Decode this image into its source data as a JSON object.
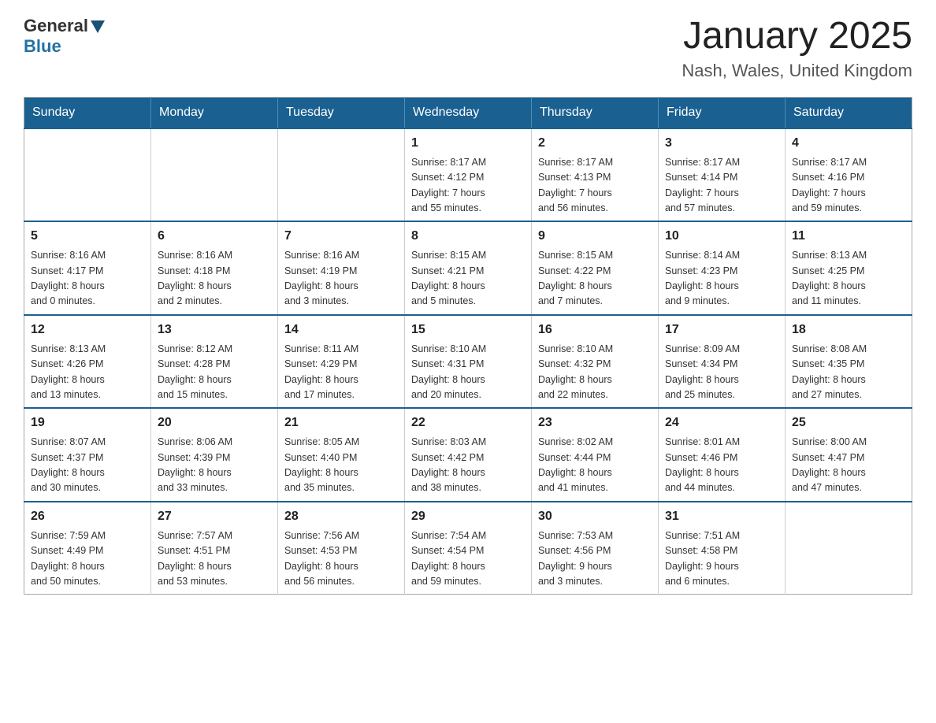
{
  "logo": {
    "general": "General",
    "arrow_shape": "triangle",
    "blue": "Blue"
  },
  "header": {
    "title": "January 2025",
    "subtitle": "Nash, Wales, United Kingdom"
  },
  "weekdays": [
    "Sunday",
    "Monday",
    "Tuesday",
    "Wednesday",
    "Thursday",
    "Friday",
    "Saturday"
  ],
  "weeks": [
    [
      {
        "day": "",
        "info": ""
      },
      {
        "day": "",
        "info": ""
      },
      {
        "day": "",
        "info": ""
      },
      {
        "day": "1",
        "info": "Sunrise: 8:17 AM\nSunset: 4:12 PM\nDaylight: 7 hours\nand 55 minutes."
      },
      {
        "day": "2",
        "info": "Sunrise: 8:17 AM\nSunset: 4:13 PM\nDaylight: 7 hours\nand 56 minutes."
      },
      {
        "day": "3",
        "info": "Sunrise: 8:17 AM\nSunset: 4:14 PM\nDaylight: 7 hours\nand 57 minutes."
      },
      {
        "day": "4",
        "info": "Sunrise: 8:17 AM\nSunset: 4:16 PM\nDaylight: 7 hours\nand 59 minutes."
      }
    ],
    [
      {
        "day": "5",
        "info": "Sunrise: 8:16 AM\nSunset: 4:17 PM\nDaylight: 8 hours\nand 0 minutes."
      },
      {
        "day": "6",
        "info": "Sunrise: 8:16 AM\nSunset: 4:18 PM\nDaylight: 8 hours\nand 2 minutes."
      },
      {
        "day": "7",
        "info": "Sunrise: 8:16 AM\nSunset: 4:19 PM\nDaylight: 8 hours\nand 3 minutes."
      },
      {
        "day": "8",
        "info": "Sunrise: 8:15 AM\nSunset: 4:21 PM\nDaylight: 8 hours\nand 5 minutes."
      },
      {
        "day": "9",
        "info": "Sunrise: 8:15 AM\nSunset: 4:22 PM\nDaylight: 8 hours\nand 7 minutes."
      },
      {
        "day": "10",
        "info": "Sunrise: 8:14 AM\nSunset: 4:23 PM\nDaylight: 8 hours\nand 9 minutes."
      },
      {
        "day": "11",
        "info": "Sunrise: 8:13 AM\nSunset: 4:25 PM\nDaylight: 8 hours\nand 11 minutes."
      }
    ],
    [
      {
        "day": "12",
        "info": "Sunrise: 8:13 AM\nSunset: 4:26 PM\nDaylight: 8 hours\nand 13 minutes."
      },
      {
        "day": "13",
        "info": "Sunrise: 8:12 AM\nSunset: 4:28 PM\nDaylight: 8 hours\nand 15 minutes."
      },
      {
        "day": "14",
        "info": "Sunrise: 8:11 AM\nSunset: 4:29 PM\nDaylight: 8 hours\nand 17 minutes."
      },
      {
        "day": "15",
        "info": "Sunrise: 8:10 AM\nSunset: 4:31 PM\nDaylight: 8 hours\nand 20 minutes."
      },
      {
        "day": "16",
        "info": "Sunrise: 8:10 AM\nSunset: 4:32 PM\nDaylight: 8 hours\nand 22 minutes."
      },
      {
        "day": "17",
        "info": "Sunrise: 8:09 AM\nSunset: 4:34 PM\nDaylight: 8 hours\nand 25 minutes."
      },
      {
        "day": "18",
        "info": "Sunrise: 8:08 AM\nSunset: 4:35 PM\nDaylight: 8 hours\nand 27 minutes."
      }
    ],
    [
      {
        "day": "19",
        "info": "Sunrise: 8:07 AM\nSunset: 4:37 PM\nDaylight: 8 hours\nand 30 minutes."
      },
      {
        "day": "20",
        "info": "Sunrise: 8:06 AM\nSunset: 4:39 PM\nDaylight: 8 hours\nand 33 minutes."
      },
      {
        "day": "21",
        "info": "Sunrise: 8:05 AM\nSunset: 4:40 PM\nDaylight: 8 hours\nand 35 minutes."
      },
      {
        "day": "22",
        "info": "Sunrise: 8:03 AM\nSunset: 4:42 PM\nDaylight: 8 hours\nand 38 minutes."
      },
      {
        "day": "23",
        "info": "Sunrise: 8:02 AM\nSunset: 4:44 PM\nDaylight: 8 hours\nand 41 minutes."
      },
      {
        "day": "24",
        "info": "Sunrise: 8:01 AM\nSunset: 4:46 PM\nDaylight: 8 hours\nand 44 minutes."
      },
      {
        "day": "25",
        "info": "Sunrise: 8:00 AM\nSunset: 4:47 PM\nDaylight: 8 hours\nand 47 minutes."
      }
    ],
    [
      {
        "day": "26",
        "info": "Sunrise: 7:59 AM\nSunset: 4:49 PM\nDaylight: 8 hours\nand 50 minutes."
      },
      {
        "day": "27",
        "info": "Sunrise: 7:57 AM\nSunset: 4:51 PM\nDaylight: 8 hours\nand 53 minutes."
      },
      {
        "day": "28",
        "info": "Sunrise: 7:56 AM\nSunset: 4:53 PM\nDaylight: 8 hours\nand 56 minutes."
      },
      {
        "day": "29",
        "info": "Sunrise: 7:54 AM\nSunset: 4:54 PM\nDaylight: 8 hours\nand 59 minutes."
      },
      {
        "day": "30",
        "info": "Sunrise: 7:53 AM\nSunset: 4:56 PM\nDaylight: 9 hours\nand 3 minutes."
      },
      {
        "day": "31",
        "info": "Sunrise: 7:51 AM\nSunset: 4:58 PM\nDaylight: 9 hours\nand 6 minutes."
      },
      {
        "day": "",
        "info": ""
      }
    ]
  ]
}
